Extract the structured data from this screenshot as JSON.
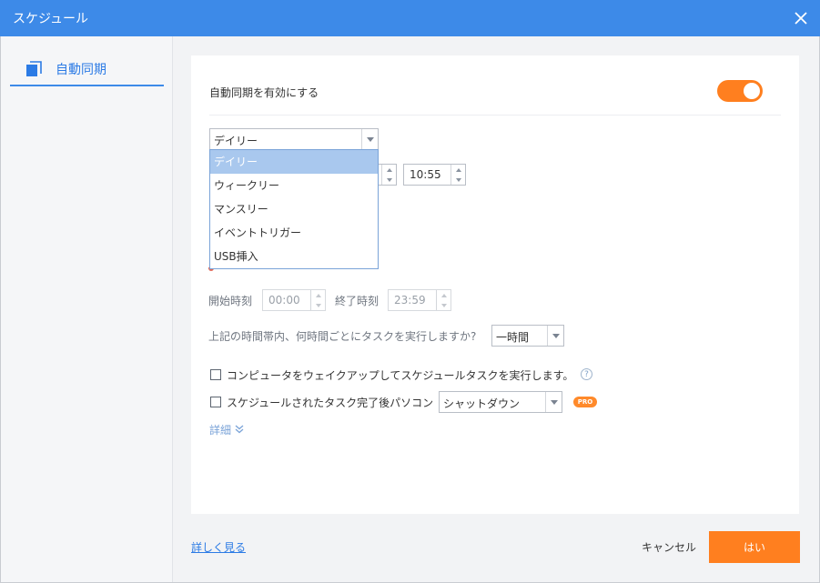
{
  "window": {
    "title": "スケジュール"
  },
  "sidebar": {
    "items": [
      {
        "label": "自動同期",
        "icon": "copy-icon"
      }
    ]
  },
  "enable": {
    "label": "自動同期を有効にする",
    "on": true
  },
  "frequency": {
    "selected": "デイリー",
    "options": [
      "デイリー",
      "ウィークリー",
      "マンスリー",
      "イベントトリガー",
      "USB挿入"
    ]
  },
  "time": {
    "value": "10:55"
  },
  "window_range": {
    "start_label": "開始時刻",
    "start_value": "00:00",
    "end_label": "終了時刻",
    "end_value": "23:59"
  },
  "interval": {
    "question": "上記の時間帯内、何時間ごとにタスクを実行しますか?",
    "value": "一時間"
  },
  "wake": {
    "label": "コンピュータをウェイクアップしてスケジュールタスクを実行します。",
    "checked": false,
    "help": "?"
  },
  "after": {
    "label": "スケジュールされたタスク完了後パソコン",
    "checked": false,
    "action": "シャットダウン",
    "badge": "PRO"
  },
  "details": {
    "label": "詳細"
  },
  "footer": {
    "learn_more": "詳しく見る",
    "cancel": "キャンセル",
    "ok": "はい"
  },
  "colors": {
    "accent": "#3d8ae8",
    "orange": "#ff7f1f"
  }
}
